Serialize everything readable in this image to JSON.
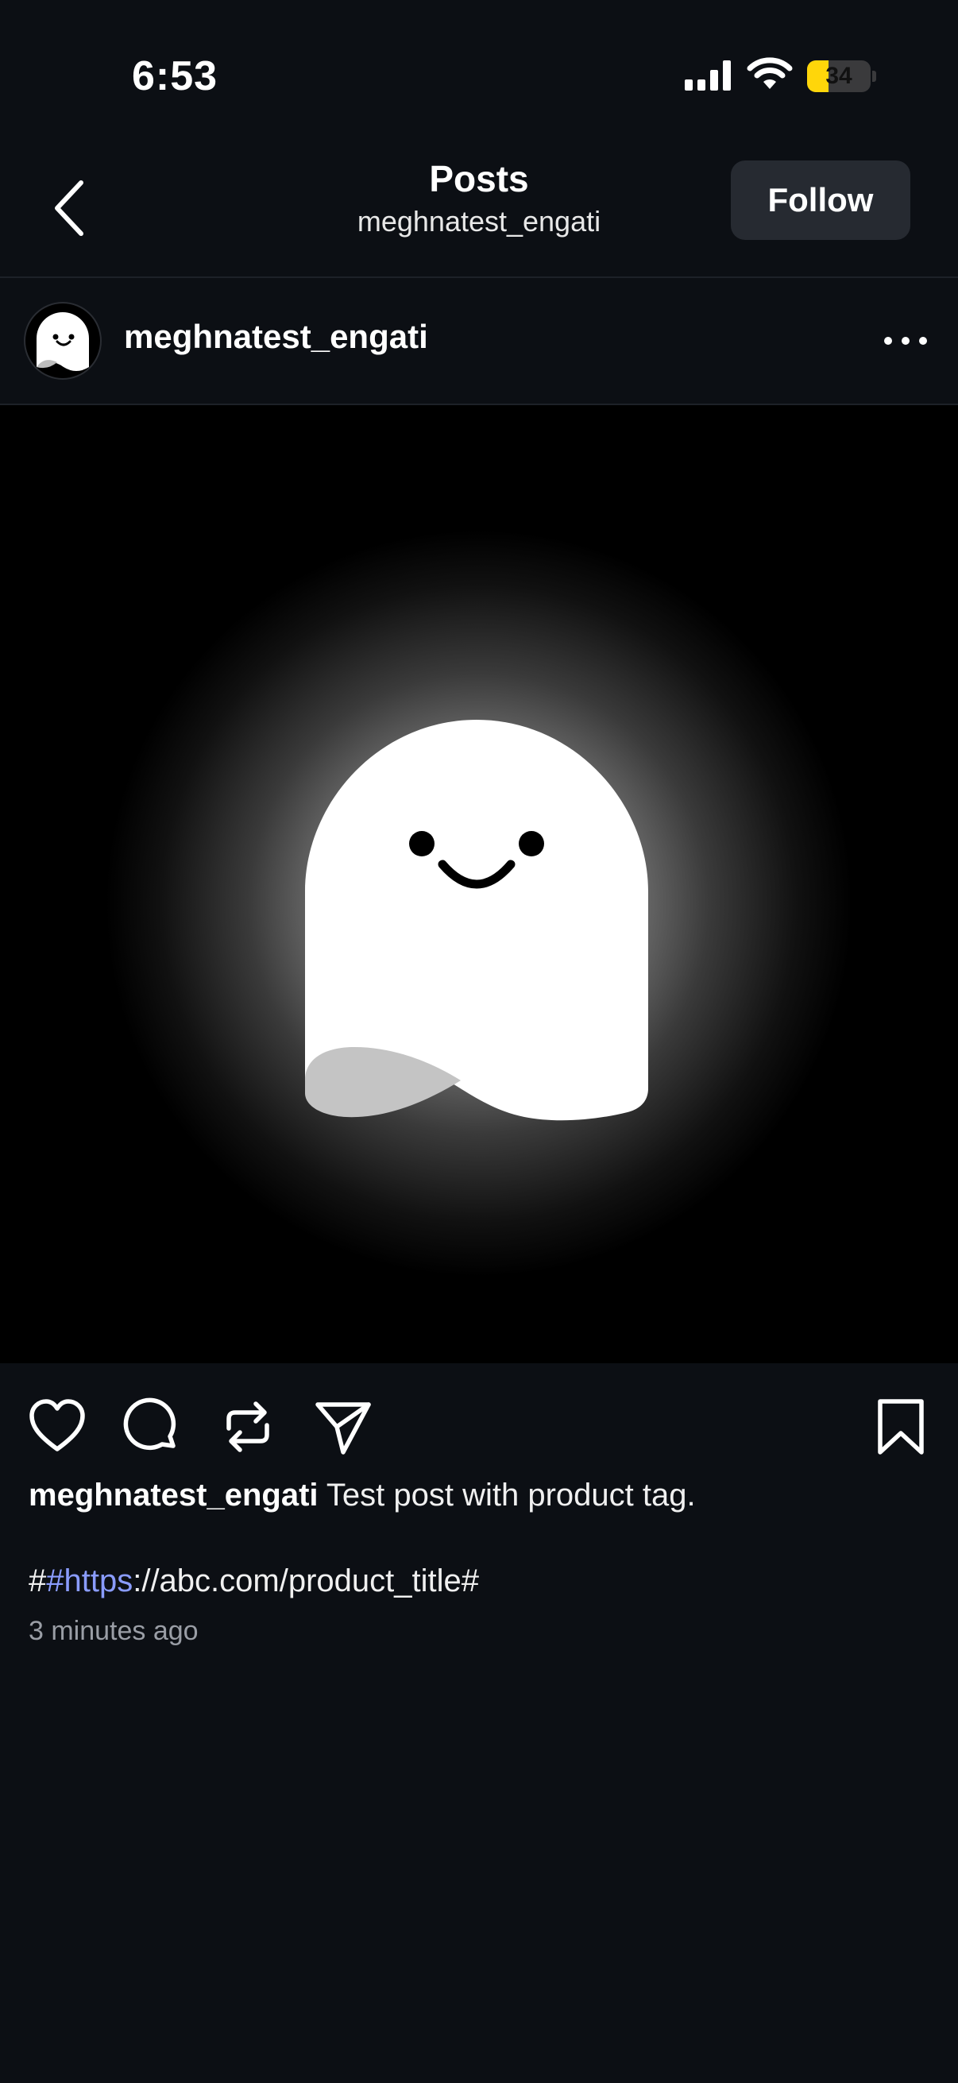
{
  "status_bar": {
    "time": "6:53",
    "battery_level": "34",
    "battery_fraction": 0.34,
    "battery_color": "#ffd60a"
  },
  "nav": {
    "title": "Posts",
    "subtitle": "meghnatest_engati",
    "follow_label": "Follow"
  },
  "post": {
    "username": "meghnatest_engati",
    "caption_username": "meghnatest_engati",
    "caption_text": " Test post with product tag.",
    "link_prefix": "#",
    "link_hashtag": "#https",
    "link_suffix": "://abc.com/product_title#",
    "timestamp": "3 minutes ago",
    "link_color": "#8a9cff"
  },
  "icons": {
    "back": "chevron-left-icon",
    "more": "more-horizontal-icon",
    "like": "heart-icon",
    "comment": "comment-icon",
    "repost": "repost-icon",
    "share": "send-icon",
    "save": "bookmark-icon"
  }
}
